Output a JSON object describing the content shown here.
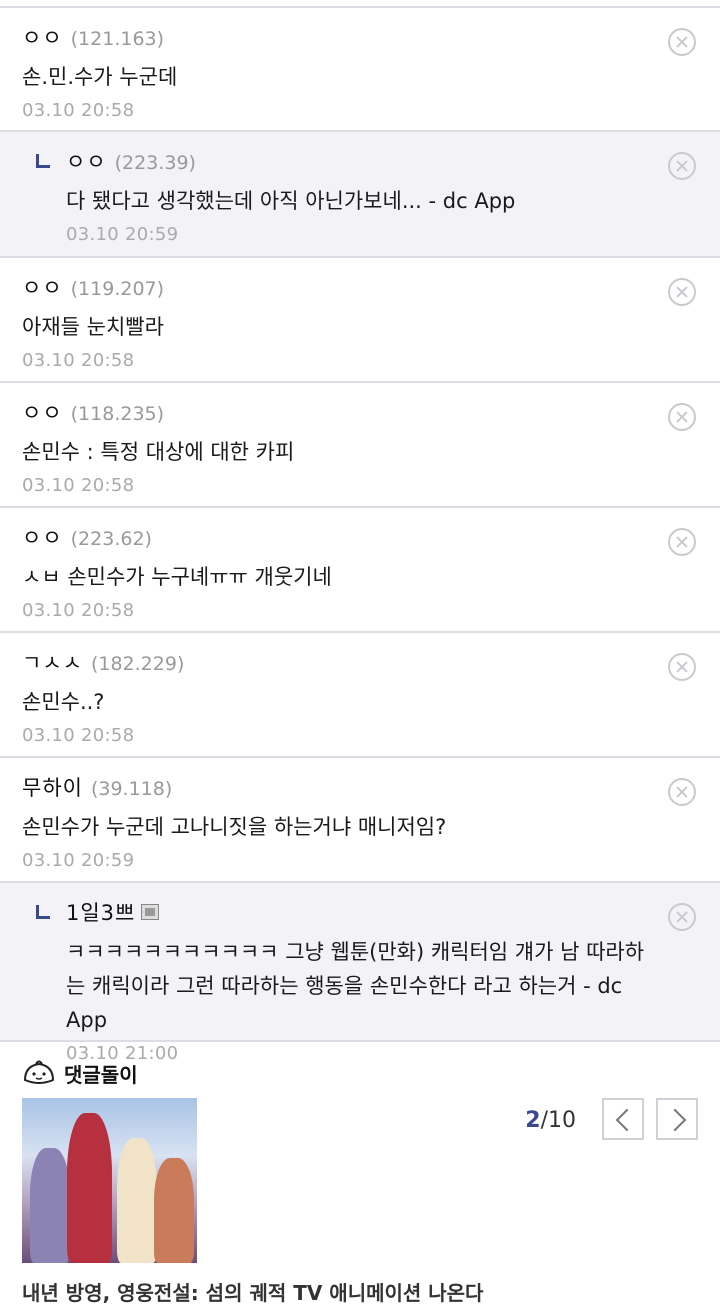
{
  "comments": [
    {
      "author": "ㅇㅇ",
      "ip": "(121.163)",
      "text": "손.민.수가 누군데",
      "date": "03.10 20:58",
      "reply": false
    },
    {
      "author": "ㅇㅇ",
      "ip": "(223.39)",
      "text": "다 됐다고 생각했는데 아직 아닌가보네... - dc App",
      "date": "03.10 20:59",
      "reply": true
    },
    {
      "author": "ㅇㅇ",
      "ip": "(119.207)",
      "text": "아재들 눈치빨라",
      "date": "03.10 20:58",
      "reply": false
    },
    {
      "author": "ㅇㅇ",
      "ip": "(118.235)",
      "text": "손민수 : 특정 대상에 대한 카피",
      "date": "03.10 20:58",
      "reply": false
    },
    {
      "author": "ㅇㅇ",
      "ip": "(223.62)",
      "text": "ㅅㅂ 손민수가 누구녜ㅠㅠ 개웃기네",
      "date": "03.10 20:58",
      "reply": false
    },
    {
      "author": "ㄱㅅㅅ",
      "ip": "(182.229)",
      "text": "손민수..?",
      "date": "03.10 20:58",
      "reply": false
    },
    {
      "author": "무하이",
      "ip": "(39.118)",
      "text": "손민수가 누군데 고나니짓을 하는거냐 매니저임?",
      "date": "03.10 20:59",
      "reply": false
    },
    {
      "author": "1일3쁘",
      "ip": "",
      "text": "ㅋㅋㅋㅋㅋㅋㅋㅋㅋㅋㅋ 그냥 웹툰(만화) 캐릭터임 걔가 남 따라하는 캐릭이라 그런 따라하는 행동을 손민수한다 라고 하는거 - dc App",
      "date": "03.10 21:00",
      "reply": true
    }
  ],
  "bot": {
    "title": "댓글돌이",
    "page_current": "2",
    "page_total": "/10",
    "article_title": "내년 방영, 영웅전설: 섬의 궤적 TV 애니메이션 나온다"
  }
}
